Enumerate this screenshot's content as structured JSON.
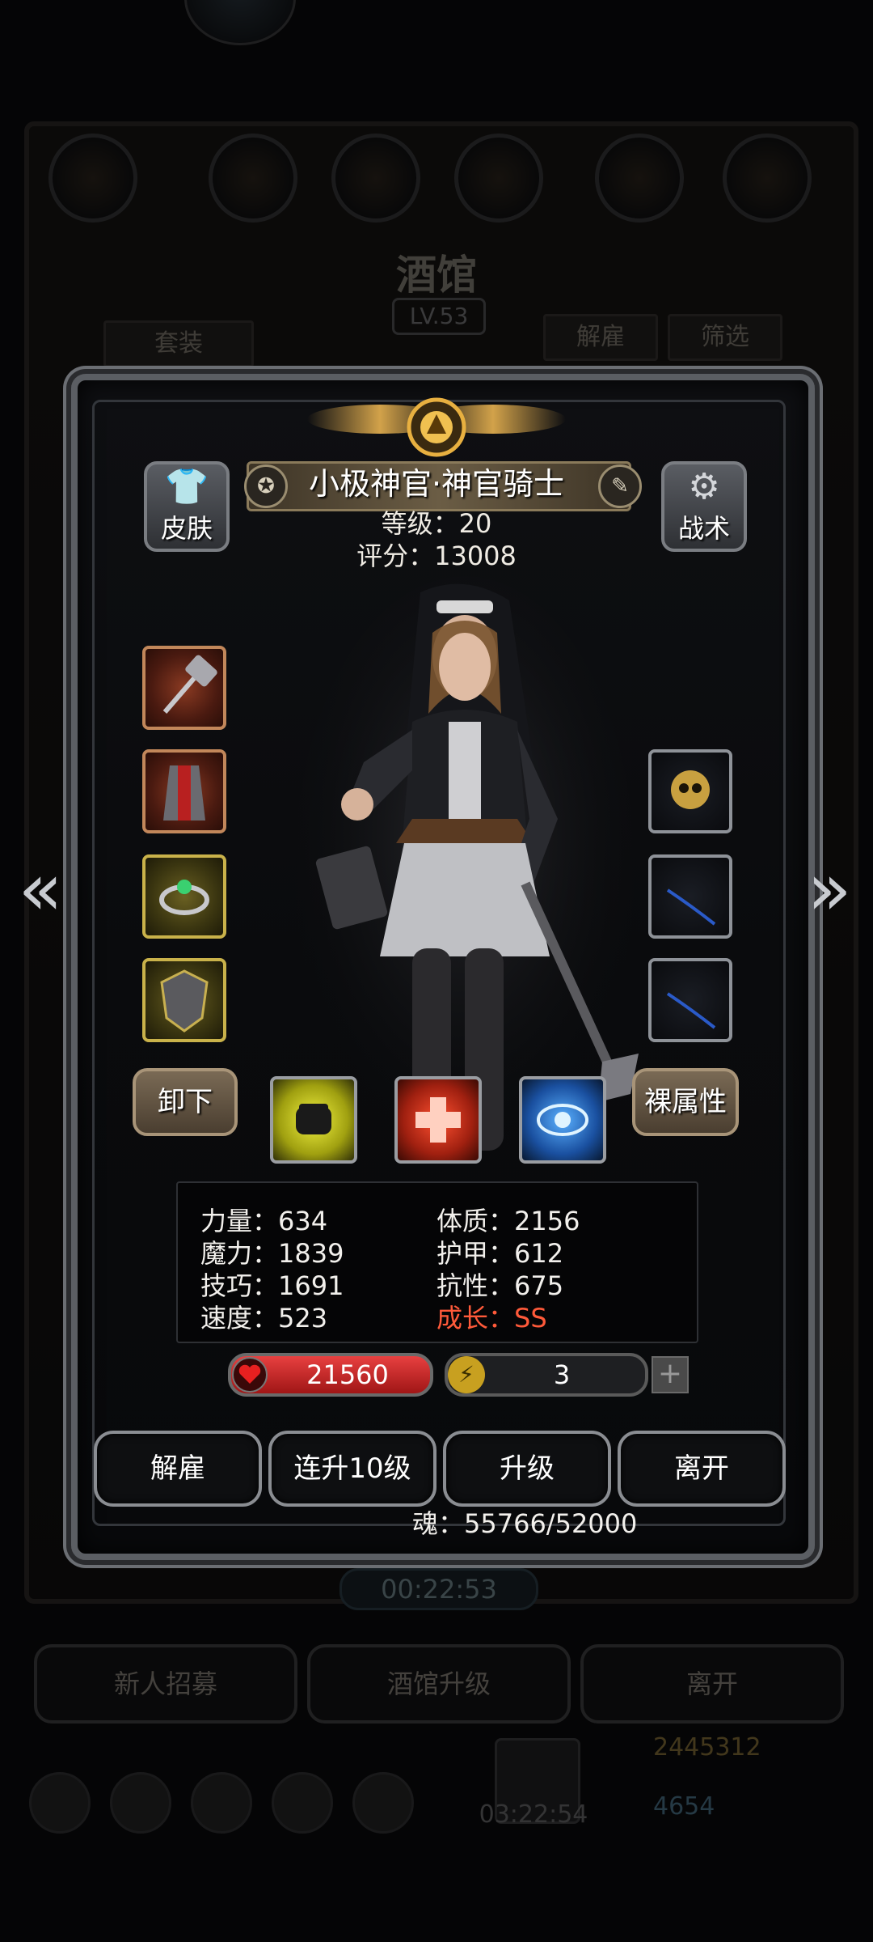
{
  "background": {
    "title": "酒馆",
    "level": "LV.53",
    "buttons": {
      "suit": "套装",
      "dismiss": "解雇",
      "filter": "筛选"
    },
    "timer": "00:22:53",
    "bottom_buttons": [
      "新人招募",
      "酒馆升级",
      "离开"
    ],
    "gift_timer": "03:22:54",
    "gold": "2445312",
    "gems": "4654"
  },
  "hero": {
    "name": "小极神官·神官骑士",
    "level_text": "等级：20",
    "score_text": "评分：13008"
  },
  "side_buttons": {
    "skin": "皮肤",
    "tactics": "战术"
  },
  "tag_buttons": {
    "unequip": "卸下",
    "bare_attr": "裸属性"
  },
  "nav": {
    "prev": "«",
    "next": "»"
  },
  "stats": {
    "strength": "力量：634",
    "constitution": "体质：2156",
    "magic": "魔力：1839",
    "armor": "护甲：612",
    "skill": "技巧：1691",
    "resistance": "抗性：675",
    "speed": "速度：523",
    "growth": "成长：SS"
  },
  "bars": {
    "hp": "21560",
    "energy": "3",
    "plus": "+"
  },
  "actions": [
    "解雇",
    "连升10级",
    "升级",
    "离开"
  ],
  "soul": "魂：55766/52000",
  "colors": {
    "growth": "#ff5a3a",
    "hp": "#c82020",
    "frame": "#5b5e63"
  }
}
